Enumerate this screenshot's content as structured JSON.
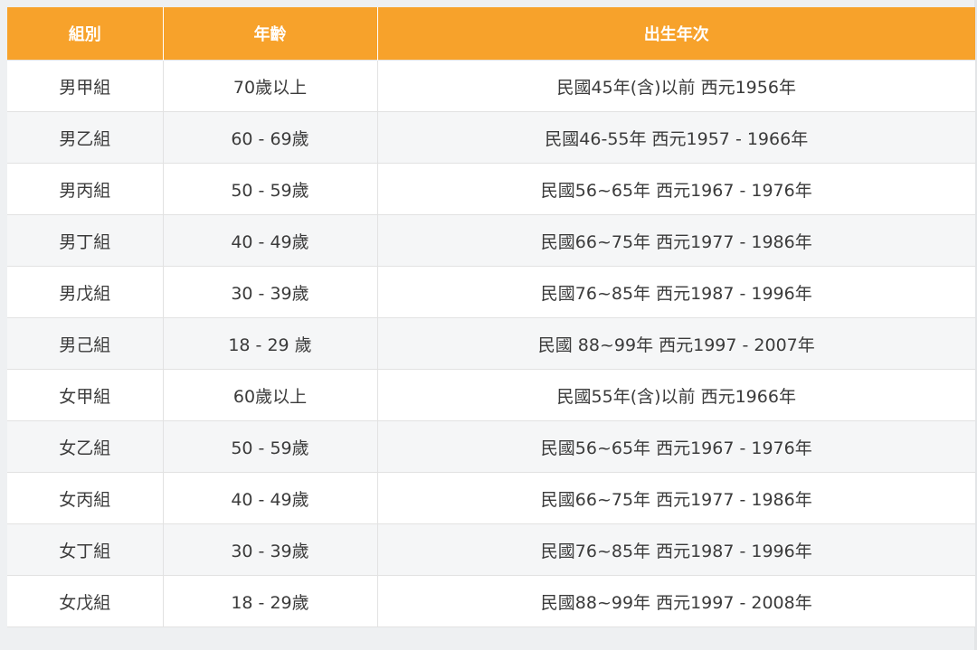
{
  "table": {
    "headers": [
      "組別",
      "年齡",
      "出生年次"
    ],
    "rows": [
      [
        "男甲組",
        "70歲以上",
        "民國45年(含)以前 西元1956年"
      ],
      [
        "男乙組",
        "60 - 69歲",
        "民國46-55年 西元1957 - 1966年"
      ],
      [
        "男丙組",
        "50 - 59歲",
        "民國56~65年 西元1967 - 1976年"
      ],
      [
        "男丁組",
        "40 - 49歲",
        "民國66~75年 西元1977 - 1986年"
      ],
      [
        "男戊組",
        "30 - 39歲",
        "民國76~85年 西元1987 - 1996年"
      ],
      [
        "男己組",
        "18 - 29 歲",
        "民國 88~99年 西元1997 - 2007年"
      ],
      [
        "女甲組",
        "60歲以上",
        "民國55年(含)以前 西元1966年"
      ],
      [
        "女乙組",
        "50 - 59歲",
        "民國56~65年 西元1967 - 1976年"
      ],
      [
        "女丙組",
        "40 - 49歲",
        "民國66~75年 西元1977 - 1986年"
      ],
      [
        "女丁組",
        "30 - 39歲",
        "民國76~85年 西元1987 - 1996年"
      ],
      [
        "女戊組",
        "18 - 29歲",
        "民國88~99年 西元1997 - 2008年"
      ]
    ]
  },
  "colors": {
    "header_bg": "#f7a22b",
    "header_text": "#ffffff",
    "row_alt_bg": "#f5f6f7",
    "text": "#3b3b3b"
  }
}
